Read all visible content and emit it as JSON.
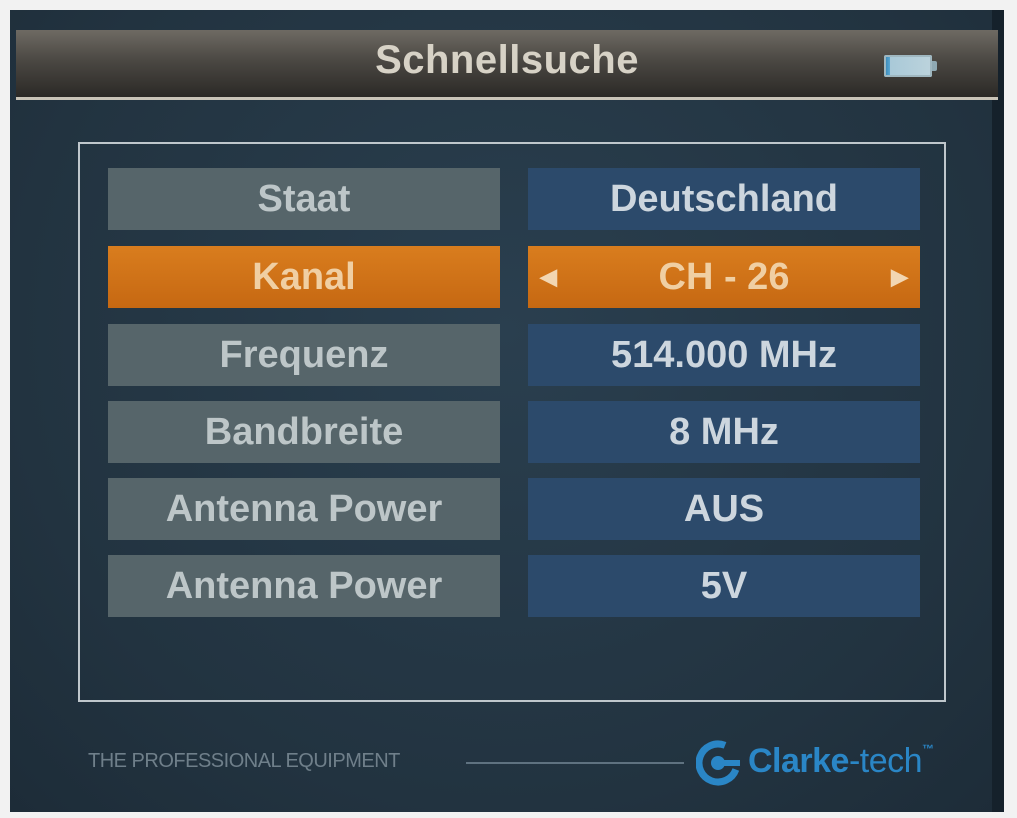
{
  "header": {
    "title": "Schnellsuche",
    "battery_icon": "battery-icon"
  },
  "settings": [
    {
      "label": "Staat",
      "value": "Deutschland",
      "selected": false
    },
    {
      "label": "Kanal",
      "value": "CH - 26",
      "selected": true
    },
    {
      "label": "Frequenz",
      "value": "514.000 MHz",
      "selected": false
    },
    {
      "label": "Bandbreite",
      "value": "8 MHz",
      "selected": false
    },
    {
      "label": "Antenna Power",
      "value": "AUS",
      "selected": false
    },
    {
      "label": "Antenna Power",
      "value": "5V",
      "selected": false
    }
  ],
  "footer": {
    "tagline": "THE PROFESSIONAL EQUIPMENT",
    "brand_main": "Clarke",
    "brand_suffix": "-tech",
    "brand_tm": "™"
  },
  "colors": {
    "background": "#243644",
    "selected": "#d97d1e",
    "label_cell": "#56656a",
    "value_cell": "#2c4a6b",
    "brand": "#2a86c6"
  }
}
